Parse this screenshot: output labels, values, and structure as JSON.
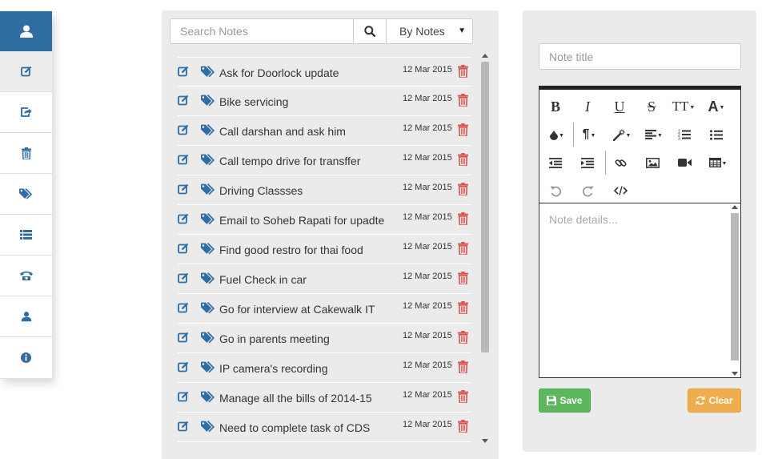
{
  "sidebar": {
    "header_icon": "user-icon",
    "items": [
      {
        "icon": "edit-icon",
        "active": true
      },
      {
        "icon": "share-icon"
      },
      {
        "icon": "trash-icon"
      },
      {
        "icon": "tags-icon"
      },
      {
        "icon": "list-icon"
      },
      {
        "icon": "phone-icon"
      },
      {
        "icon": "user-icon"
      },
      {
        "icon": "info-icon"
      }
    ]
  },
  "search": {
    "placeholder": "Search Notes",
    "value": ""
  },
  "sort": {
    "selected": "By Notes"
  },
  "notes": [
    {
      "title": "Ask for Doorlock update",
      "date": "12 Mar 2015"
    },
    {
      "title": "Bike servicing",
      "date": "12 Mar 2015"
    },
    {
      "title": "Call darshan and ask him",
      "date": "12 Mar 2015"
    },
    {
      "title": "Call tempo drive for transffer",
      "date": "12 Mar 2015"
    },
    {
      "title": "Driving Classses",
      "date": "12 Mar 2015"
    },
    {
      "title": "Email to Soheb Rapati for upadte",
      "date": "12 Mar 2015"
    },
    {
      "title": "Find good restro for thai food",
      "date": "12 Mar 2015"
    },
    {
      "title": "Fuel Check in car",
      "date": "12 Mar 2015"
    },
    {
      "title": "Go for interview at Cakewalk IT",
      "date": "12 Mar 2015"
    },
    {
      "title": "Go in parents meeting",
      "date": "12 Mar 2015"
    },
    {
      "title": "IP camera's recording",
      "date": "12 Mar 2015"
    },
    {
      "title": "Manage all the bills of 2014-15",
      "date": "12 Mar 2015"
    },
    {
      "title": "Need to complete task of CDS",
      "date": "12 Mar 2015"
    }
  ],
  "editor": {
    "title_placeholder": "Note title",
    "details_placeholder": "Note details...",
    "save_label": "Save",
    "clear_label": "Clear"
  },
  "colors": {
    "primary": "#2f6da3",
    "edit_icon": "#2f6da3",
    "tag_icon": "#2f6da3",
    "trash_icon": "#d9534f",
    "save": "#5cb85c",
    "clear": "#f0ad4e"
  }
}
